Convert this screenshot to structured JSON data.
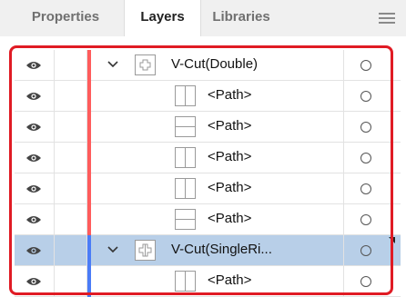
{
  "tabs": [
    {
      "label": "Properties",
      "active": false
    },
    {
      "label": "Layers",
      "active": true
    },
    {
      "label": "Libraries",
      "active": false
    }
  ],
  "menu_icon": "hamburger-menu-icon",
  "colors": {
    "highlight": "#e01b24",
    "red_layer": "#ff5c5c",
    "blue_layer": "#4a7cf7",
    "selected_row": "#b8cfe8"
  },
  "layers": [
    {
      "label": "V-Cut(Double)",
      "level": "parent",
      "expanded": true,
      "color": "red",
      "thumb": "plus-outline",
      "selected": false
    },
    {
      "label": "<Path>",
      "level": "child",
      "color": "red",
      "thumb": "vertical-line",
      "selected": false
    },
    {
      "label": "<Path>",
      "level": "child",
      "color": "red",
      "thumb": "horizontal-line",
      "selected": false
    },
    {
      "label": "<Path>",
      "level": "child",
      "color": "red",
      "thumb": "vertical-line",
      "selected": false
    },
    {
      "label": "<Path>",
      "level": "child",
      "color": "red",
      "thumb": "vertical-line",
      "selected": false
    },
    {
      "label": "<Path>",
      "level": "child",
      "color": "red",
      "thumb": "horizontal-line",
      "selected": false
    },
    {
      "label": "V-Cut(SingleRi...",
      "level": "parent",
      "expanded": true,
      "color": "blue",
      "thumb": "cross-outline",
      "selected": true
    },
    {
      "label": "<Path>",
      "level": "child",
      "color": "blue",
      "thumb": "vertical-line",
      "selected": false
    }
  ]
}
